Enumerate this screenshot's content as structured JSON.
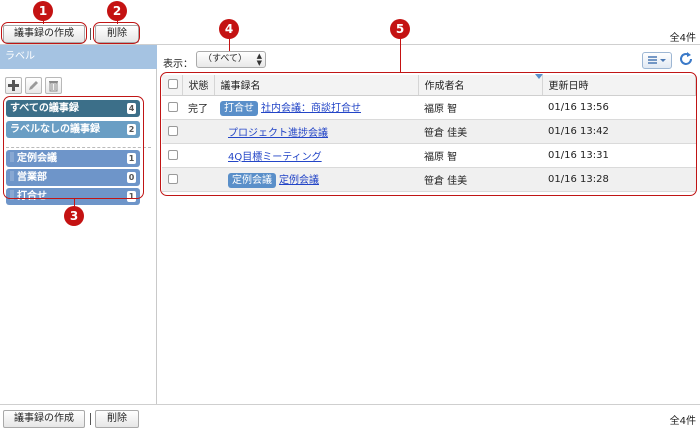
{
  "toolbar": {
    "create_label": "議事録の作成",
    "delete_label": "削除",
    "count": "全4件"
  },
  "sidebar": {
    "title": "ラベル",
    "tools": [
      "add-icon",
      "edit-icon",
      "trash-icon"
    ],
    "labels": [
      {
        "name": "すべての議事録",
        "count": "4",
        "color": "#3c6f89"
      },
      {
        "name": "ラベルなしの議事録",
        "count": "2",
        "color": "#6a9ec4"
      },
      {
        "name": "定例会議",
        "count": "1",
        "color": "#6e95c9"
      },
      {
        "name": "営業部",
        "count": "0",
        "color": "#6e95c9"
      },
      {
        "name": "打合せ",
        "count": "1",
        "color": "#6e95c9"
      }
    ]
  },
  "filter": {
    "label": "表示：",
    "selected": "（すべて）"
  },
  "table": {
    "headers": [
      "状態",
      "議事録名",
      "作成者名",
      "更新日時"
    ],
    "rows": [
      {
        "status": "完了",
        "tag": "打合せ",
        "title": "社内会議：商談打合せ",
        "author": "福原 智",
        "updated": "01/16 13:56"
      },
      {
        "status": "",
        "tag": "",
        "title": "プロジェクト進捗会議",
        "author": "笹倉 佳美",
        "updated": "01/16 13:42"
      },
      {
        "status": "",
        "tag": "",
        "title": "4Q目標ミーティング",
        "author": "福原 智",
        "updated": "01/16 13:31"
      },
      {
        "status": "",
        "tag": "定例会議",
        "title": "定例会議",
        "author": "笹倉 佳美",
        "updated": "01/16 13:28"
      }
    ]
  },
  "callouts": [
    "1",
    "2",
    "3",
    "4",
    "5"
  ],
  "colors": {
    "accent": "#c41212",
    "sidebar_header": "#a5c3e2",
    "link": "#2345c7"
  }
}
